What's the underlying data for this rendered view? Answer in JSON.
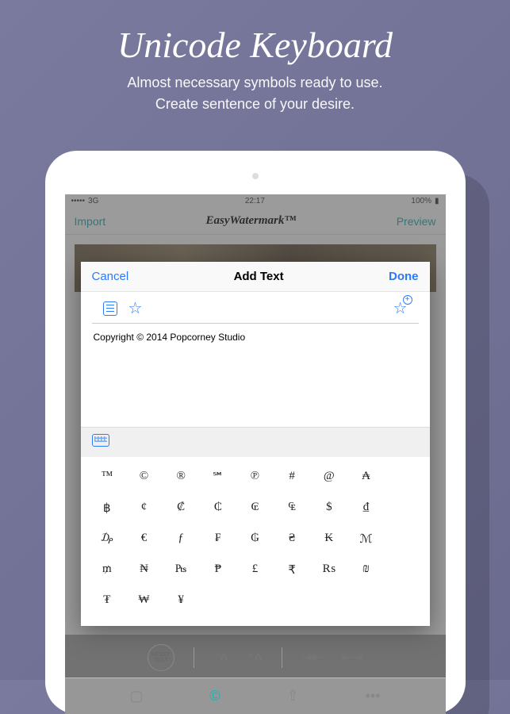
{
  "promo": {
    "title": "Unicode Keyboard",
    "subtitle_l1": "Almost necessary symbols ready to use.",
    "subtitle_l2": "Create sentence of your desire."
  },
  "status": {
    "carrier": "3G",
    "signal": "•••••",
    "time": "22:17",
    "battery": "100%"
  },
  "app_bar": {
    "left": "Import",
    "title": "EasyWatermark™",
    "right": "Preview"
  },
  "modal": {
    "cancel": "Cancel",
    "title": "Add Text",
    "done": "Done",
    "text_content": "Copyright © 2014 Popcorney Studio"
  },
  "keyboard": {
    "rows": [
      [
        "™",
        "©",
        "®",
        "℠",
        "℗",
        "#",
        "@",
        "₳"
      ],
      [
        "฿",
        "¢",
        "₡",
        "₵",
        "₢",
        "₠",
        "$",
        "₫"
      ],
      [
        "₯",
        "€",
        "ƒ",
        "₣",
        "₲",
        "₴",
        "₭",
        "ℳ"
      ],
      [
        "₥",
        "₦",
        "₧",
        "₱",
        "£",
        "₹",
        "₨",
        "₪"
      ],
      [
        "₮",
        "₩",
        "¥",
        "",
        "",
        "",
        "",
        ""
      ]
    ]
  },
  "bottom_tools": {
    "reset": "RESET\nTEXT"
  }
}
